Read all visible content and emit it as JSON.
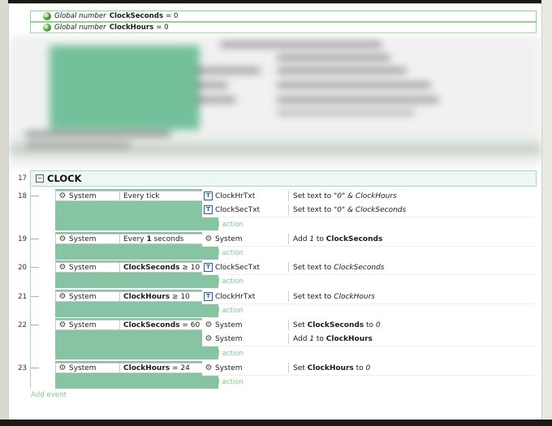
{
  "globals": [
    {
      "type": "Global number",
      "name": "ClockSeconds",
      "rest": "= 0"
    },
    {
      "type": "Global number",
      "name": "ClockHours",
      "rest": "= 0"
    }
  ],
  "group": {
    "number": "17",
    "toggle": "−",
    "title": "CLOCK"
  },
  "events": [
    {
      "number": "18",
      "cond_object": "System",
      "cond_text": "Every tick",
      "actions": [
        {
          "icon": "text-object",
          "object": "ClockHrTxt",
          "parts": [
            "Set text to ",
            "\"0\" & ClockHours"
          ]
        },
        {
          "icon": "text-object",
          "object": "ClockSecTxt",
          "parts": [
            "Set text to ",
            "\"0\" & ClockSeconds"
          ]
        }
      ]
    },
    {
      "number": "19",
      "cond_object": "System",
      "cond_pre": "Every ",
      "cond_bold": "1",
      "cond_post": " seconds",
      "actions": [
        {
          "icon": "system",
          "object": "System",
          "parts": [
            "Add ",
            "1",
            " to ",
            "ClockSeconds"
          ]
        }
      ]
    },
    {
      "number": "20",
      "cond_object": "System",
      "cond_bold": "ClockSeconds",
      "cond_post": " ≥ 10",
      "actions": [
        {
          "icon": "text-object",
          "object": "ClockSecTxt",
          "parts": [
            "Set text to ",
            "ClockSeconds"
          ]
        }
      ]
    },
    {
      "number": "21",
      "cond_object": "System",
      "cond_bold": "ClockHours",
      "cond_post": " ≥ 10",
      "actions": [
        {
          "icon": "text-object",
          "object": "ClockHrTxt",
          "parts": [
            "Set text to ",
            "ClockHours"
          ]
        }
      ]
    },
    {
      "number": "22",
      "cond_object": "System",
      "cond_bold": "ClockSeconds",
      "cond_post": " = 60",
      "actions": [
        {
          "icon": "system",
          "object": "System",
          "parts": [
            "Set ",
            "ClockSeconds",
            " to ",
            "0"
          ]
        },
        {
          "icon": "system",
          "object": "System",
          "parts": [
            "Add ",
            "1",
            " to ",
            "ClockHours"
          ]
        }
      ]
    },
    {
      "number": "23",
      "cond_object": "System",
      "cond_bold": "ClockHours",
      "cond_post": " = 24",
      "actions": [
        {
          "icon": "system",
          "object": "System",
          "parts": [
            "Set ",
            "ClockHours",
            " to ",
            "0"
          ]
        }
      ]
    }
  ],
  "add_action_label": "Add action",
  "add_event_label": "Add event",
  "colors": {
    "condition_fill": "#86c4a3",
    "add_link": "#7ecb8e",
    "group_border": "#a7dcc0"
  }
}
